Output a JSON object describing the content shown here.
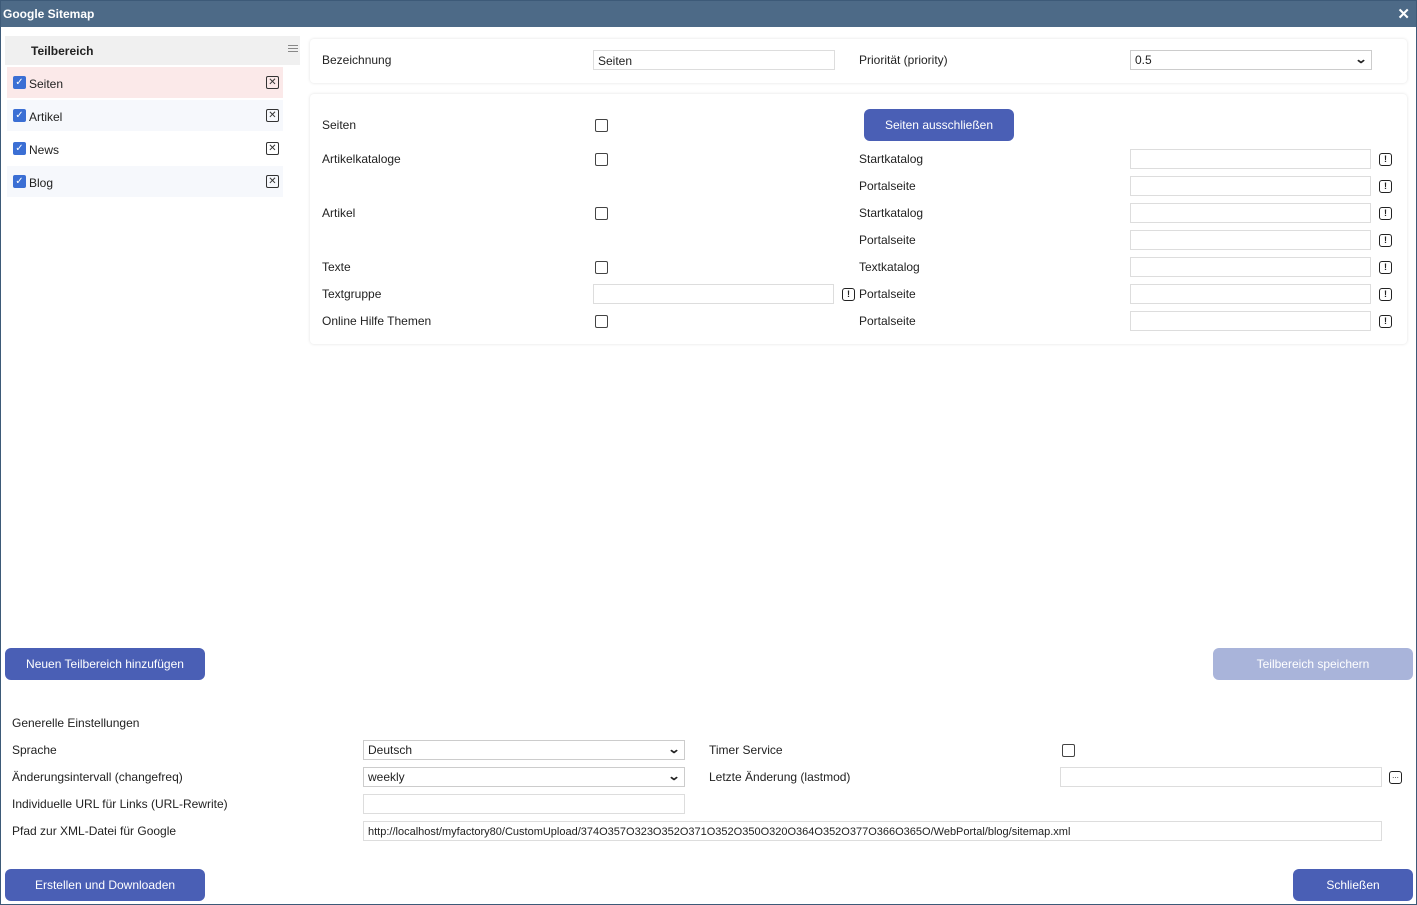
{
  "window": {
    "title": "Google Sitemap"
  },
  "sidebar": {
    "header": "Teilbereich",
    "items": [
      {
        "label": "Seiten",
        "checked": true,
        "selected": true
      },
      {
        "label": "Artikel",
        "checked": true
      },
      {
        "label": "News",
        "checked": true
      },
      {
        "label": "Blog",
        "checked": true
      }
    ]
  },
  "top_panel": {
    "bezeichnung_label": "Bezeichnung",
    "bezeichnung_value": "Seiten",
    "priority_label": "Priorität (priority)",
    "priority_value": "0.5"
  },
  "detail_panel": {
    "seiten_label": "Seiten",
    "exclude_button": "Seiten ausschließen",
    "artikelkataloge_label": "Artikelkataloge",
    "artikel_label": "Artikel",
    "texte_label": "Texte",
    "textgruppe_label": "Textgruppe",
    "online_hilfe_label": "Online Hilfe Themen",
    "startkatalog_label": "Startkatalog",
    "portalseite_label": "Portalseite",
    "textkatalog_label": "Textkatalog"
  },
  "actions": {
    "add_section": "Neuen Teilbereich hinzufügen",
    "save_section": "Teilbereich speichern"
  },
  "general": {
    "heading": "Generelle Einstellungen",
    "sprache_label": "Sprache",
    "sprache_value": "Deutsch",
    "changefreq_label": "Änderungsintervall (changefreq)",
    "changefreq_value": "weekly",
    "urlrewrite_label": "Individuelle URL für Links (URL-Rewrite)",
    "xmlpath_label": "Pfad zur XML-Datei für Google",
    "xmlpath_value": "http://localhost/myfactory80/CustomUpload/374O357O323O352O371O352O350O320O364O352O377O366O365O/WebPortal/blog/sitemap.xml",
    "timer_label": "Timer Service",
    "lastmod_label": "Letzte Änderung (lastmod)"
  },
  "footer": {
    "create_download": "Erstellen und Downloaden",
    "close": "Schließen"
  },
  "colors": {
    "titlebar": "#4d6a87",
    "primary_button": "#4a5fb5",
    "disabled_button": "#a9b4da",
    "selected_item": "#fbe9e9",
    "item_bg": "#f6f8fc"
  }
}
